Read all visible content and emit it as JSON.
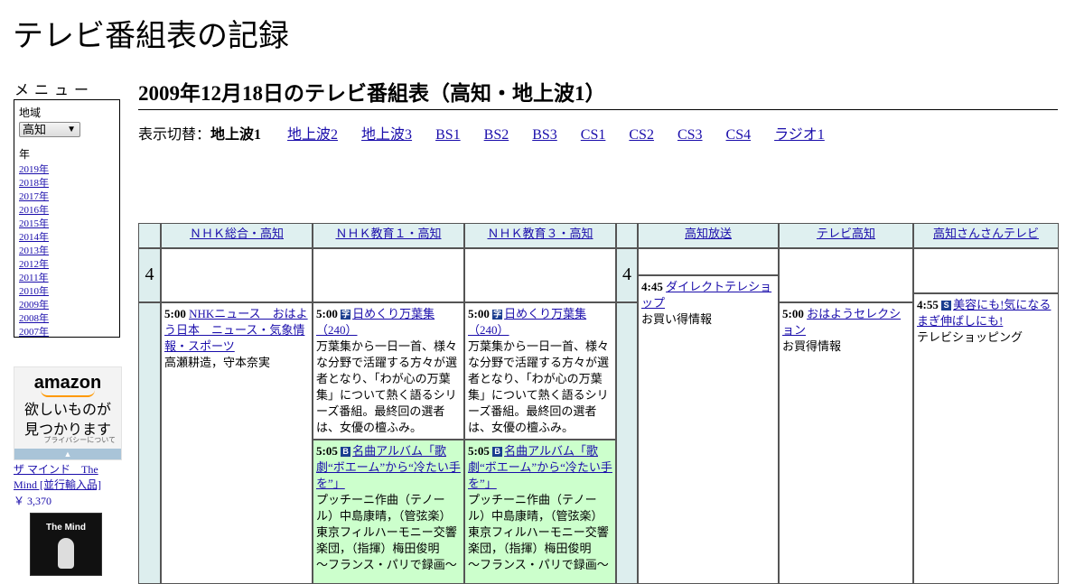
{
  "site_title": "テレビ番組表の記録",
  "sidebar": {
    "menu_heading": "メニュー",
    "region_label": "地域",
    "region_value": "高知",
    "year_label": "年",
    "years": [
      "2019年",
      "2018年",
      "2017年",
      "2016年",
      "2015年",
      "2014年",
      "2013年",
      "2012年",
      "2011年",
      "2010年",
      "2009年",
      "2008年",
      "2007年"
    ]
  },
  "ad": {
    "logo": "amazon",
    "line1": "欲しいものが",
    "line2": "見つかります",
    "privacy": "プライバシーについて",
    "product_name": "ザ マインド　The Mind [並行輸入品]",
    "price": "￥ 3,370",
    "image_text": "The Mind"
  },
  "page_heading": "2009年12月18日のテレビ番組表（高知・地上波1）",
  "switcher": {
    "label": "表示切替：",
    "current": "地上波1",
    "links": [
      "地上波2",
      "地上波3",
      "BS1",
      "BS2",
      "BS3",
      "CS1",
      "CS2",
      "CS3",
      "CS4",
      "ラジオ1"
    ]
  },
  "channels": [
    "ＮＨＫ総合・高知",
    "ＮＨＫ教育１・高知",
    "ＮＨＫ教育３・高知",
    "高知放送",
    "テレビ高知",
    "高知さんさんテレビ"
  ],
  "hour": "4",
  "programs": {
    "nhk_general": {
      "time": "5:00",
      "title": "NHKニュース　おはよう日本　ニュース・気象情報・スポーツ",
      "desc": "高瀬耕造，守本奈実"
    },
    "edu1_a": {
      "time": "5:00",
      "icon": "字",
      "title": "日めくり万葉集（240）",
      "desc": "万葉集から一日一首、様々な分野で活躍する方々が選者となり、「わが心の万葉集」について熱く語るシリーズ番組。最終回の選者は、女優の檀ふみ。"
    },
    "edu3_a": {
      "time": "5:00",
      "icon": "字",
      "title": "日めくり万葉集（240）",
      "desc": "万葉集から一日一首、様々な分野で活躍する方々が選者となり、「わが心の万葉集」について熱く語るシリーズ番組。最終回の選者は、女優の檀ふみ。"
    },
    "edu1_b": {
      "time": "5:05",
      "icon": "B",
      "title": "名曲アルバム「歌劇“ボエーム”から“冷たい手を”」",
      "desc": "プッチーニ作曲（テノール）中島康晴，（管弦楽）東京フィルハーモニー交響楽団，（指揮）梅田俊明　～フランス・パリで録画～"
    },
    "edu3_b": {
      "time": "5:05",
      "icon": "B",
      "title": "名曲アルバム「歌劇“ボエーム”から“冷たい手を”」",
      "desc": "プッチーニ作曲（テノール）中島康晴，（管弦楽）東京フィルハーモニー交響楽団，（指揮）梅田俊明　～フランス・パリで録画～"
    },
    "kochi_hoso": {
      "time": "4:45",
      "title": "ダイレクトテレショップ",
      "desc": "お買い得情報"
    },
    "tv_kochi": {
      "time": "5:00",
      "title": "おはようセレクション",
      "desc": "お買得情報"
    },
    "sansan": {
      "time": "4:55",
      "icon": "S",
      "title": "美容にも!気になるまぎ伸ばしにも!",
      "desc": "テレビショッピング"
    }
  },
  "colors": {
    "link": "#1a0dab",
    "header_bg": "#dff0f0",
    "green_bg": "#ccffcc"
  }
}
